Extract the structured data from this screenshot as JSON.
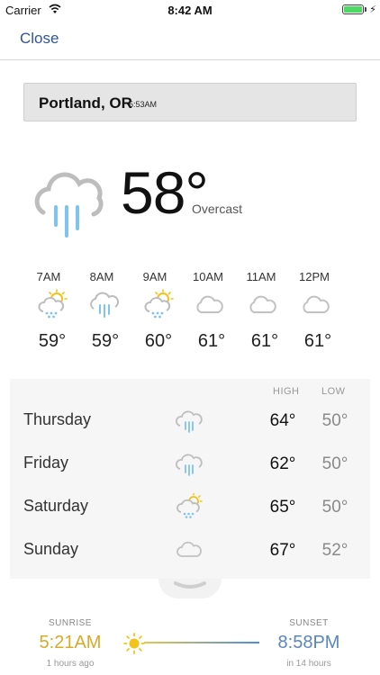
{
  "status_bar": {
    "carrier": "Carrier",
    "time": "8:42 AM",
    "battery_level": 1.0
  },
  "nav": {
    "close_label": "Close"
  },
  "location": {
    "city": "Portland, OR",
    "time": "5:53AM"
  },
  "current": {
    "temp": "58°",
    "condition": "Overcast",
    "icon": "rain-cloud-icon"
  },
  "hourly": [
    {
      "time": "7AM",
      "icon": "partly-sunny-rain-icon",
      "temp": "59°"
    },
    {
      "time": "8AM",
      "icon": "rain-cloud-icon",
      "temp": "59°"
    },
    {
      "time": "9AM",
      "icon": "partly-sunny-rain-icon",
      "temp": "60°"
    },
    {
      "time": "10AM",
      "icon": "cloud-icon",
      "temp": "61°"
    },
    {
      "time": "11AM",
      "icon": "cloud-icon",
      "temp": "61°"
    },
    {
      "time": "12PM",
      "icon": "cloud-icon",
      "temp": "61°"
    }
  ],
  "daily": {
    "high_label": "HIGH",
    "low_label": "LOW",
    "days": [
      {
        "day": "Thursday",
        "icon": "rain-cloud-icon",
        "high": "64°",
        "low": "50°"
      },
      {
        "day": "Friday",
        "icon": "rain-cloud-icon",
        "high": "62°",
        "low": "50°"
      },
      {
        "day": "Saturday",
        "icon": "partly-sunny-rain-icon",
        "high": "65°",
        "low": "50°"
      },
      {
        "day": "Sunday",
        "icon": "cloud-icon",
        "high": "67°",
        "low": "52°"
      }
    ]
  },
  "sun": {
    "sunrise_label": "SUNRISE",
    "sunrise_time": "5:21AM",
    "sunrise_sub": "1 hours ago",
    "sunset_label": "SUNSET",
    "sunset_time": "8:58PM",
    "sunset_sub": "in 14 hours"
  },
  "colors": {
    "accent": "#2f5597",
    "rain": "#7ec4ee",
    "sun": "#f0c419",
    "sunrise": "#d7aa2a",
    "sunset": "#5b87b8"
  }
}
